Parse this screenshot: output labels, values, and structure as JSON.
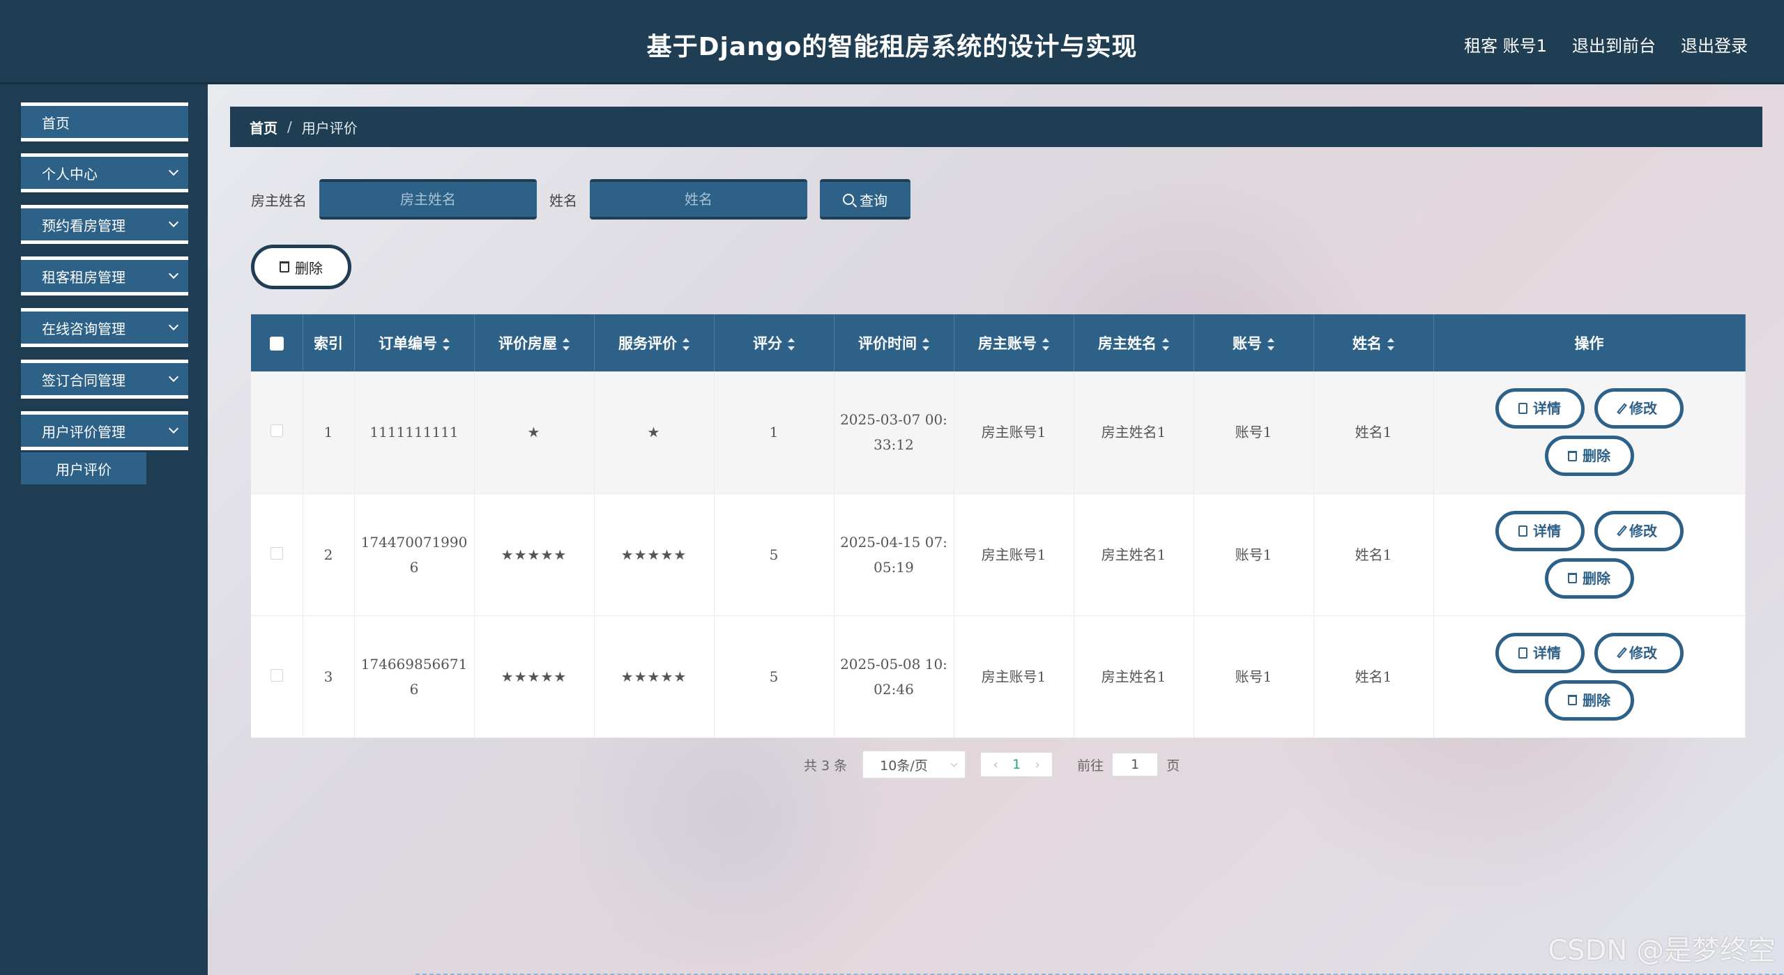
{
  "header": {
    "title": "基于Django的智能租房系统的设计与实现",
    "user": "租客 账号1",
    "front_link": "退出到前台",
    "logout_link": "退出登录"
  },
  "sidebar": {
    "items": [
      {
        "label": "首页"
      },
      {
        "label": "个人中心"
      },
      {
        "label": "预约看房管理"
      },
      {
        "label": "租客租房管理"
      },
      {
        "label": "在线咨询管理"
      },
      {
        "label": "签订合同管理"
      },
      {
        "label": "用户评价管理"
      }
    ],
    "submenu": {
      "label": "用户评价"
    }
  },
  "breadcrumb": {
    "home": "首页",
    "separator": "/",
    "current": "用户评价"
  },
  "search": {
    "owner_label": "房主姓名",
    "owner_placeholder": "房主姓名",
    "name_label": "姓名",
    "name_placeholder": "姓名",
    "query_label": "查询"
  },
  "bulk_delete_label": "删除",
  "table": {
    "headers": [
      "索引",
      "订单编号",
      "评价房屋",
      "服务评价",
      "评分",
      "评价时间",
      "房主账号",
      "房主姓名",
      "账号",
      "姓名",
      "操作"
    ],
    "rows": [
      {
        "index": "1",
        "order_no": "1111111111",
        "house_rating": "★",
        "service_rating": "★",
        "score": "1",
        "time": "2025-03-07 00:33:12",
        "owner_account": "房主账号1",
        "owner_name": "房主姓名1",
        "account": "账号1",
        "name": "姓名1"
      },
      {
        "index": "2",
        "order_no": "1744700719906",
        "house_rating": "★★★★★",
        "service_rating": "★★★★★",
        "score": "5",
        "time": "2025-04-15 07:05:19",
        "owner_account": "房主账号1",
        "owner_name": "房主姓名1",
        "account": "账号1",
        "name": "姓名1"
      },
      {
        "index": "3",
        "order_no": "1746698566716",
        "house_rating": "★★★★★",
        "service_rating": "★★★★★",
        "score": "5",
        "time": "2025-05-08 10:02:46",
        "owner_account": "房主账号1",
        "owner_name": "房主姓名1",
        "account": "账号1",
        "name": "姓名1"
      }
    ],
    "actions": {
      "detail": "详情",
      "edit": "修改",
      "delete": "删除"
    }
  },
  "pagination": {
    "total": "共 3 条",
    "page_size": "10条/页",
    "prev": "‹",
    "current_page": "1",
    "next": "›",
    "goto_label": "前往",
    "goto_value": "1",
    "page_suffix": "页"
  },
  "watermark": "CSDN @是梦终空",
  "colors": {
    "header_bg": "#203e53",
    "accent": "#2e6188",
    "active_page": "#2aa57d"
  }
}
